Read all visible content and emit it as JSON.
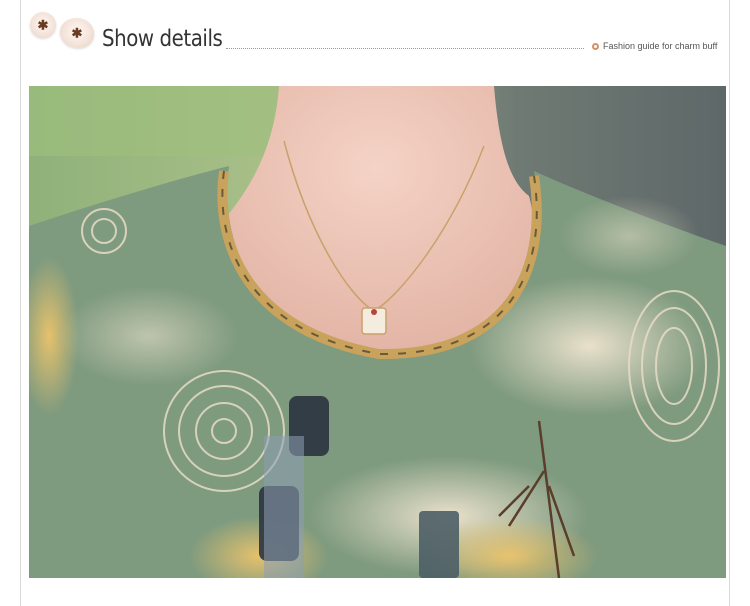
{
  "header": {
    "title": "Show details",
    "subtitle": "Fashion guide for charm buff",
    "flower_icons": [
      "flower-icon",
      "flower-icon"
    ],
    "accent_color": "#d7905f"
  },
  "photo": {
    "subject": "product-photo"
  }
}
